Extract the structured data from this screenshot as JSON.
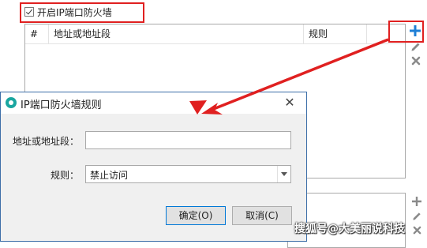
{
  "firewall": {
    "enable_label": "开启IP端口防火墙",
    "enabled": true,
    "columns": [
      "#",
      "地址或地址段",
      "规则"
    ]
  },
  "tools": {
    "add_icon": "plus-icon",
    "edit_icon": "pencil-icon",
    "delete_icon": "close-x-icon"
  },
  "dialog": {
    "title": "IP端口防火墙规则",
    "address_label": "地址或地址段：",
    "address_value": "",
    "rule_label": "规则：",
    "rule_value": "禁止访问",
    "ok_label": "确定(O)",
    "cancel_label": "取消(C)"
  },
  "watermark": "搜狐号@大美丽说科技",
  "colors": {
    "highlight": "#e02020",
    "accent_blue": "#1e7fd6",
    "icon_gray": "#8a8a8a"
  }
}
